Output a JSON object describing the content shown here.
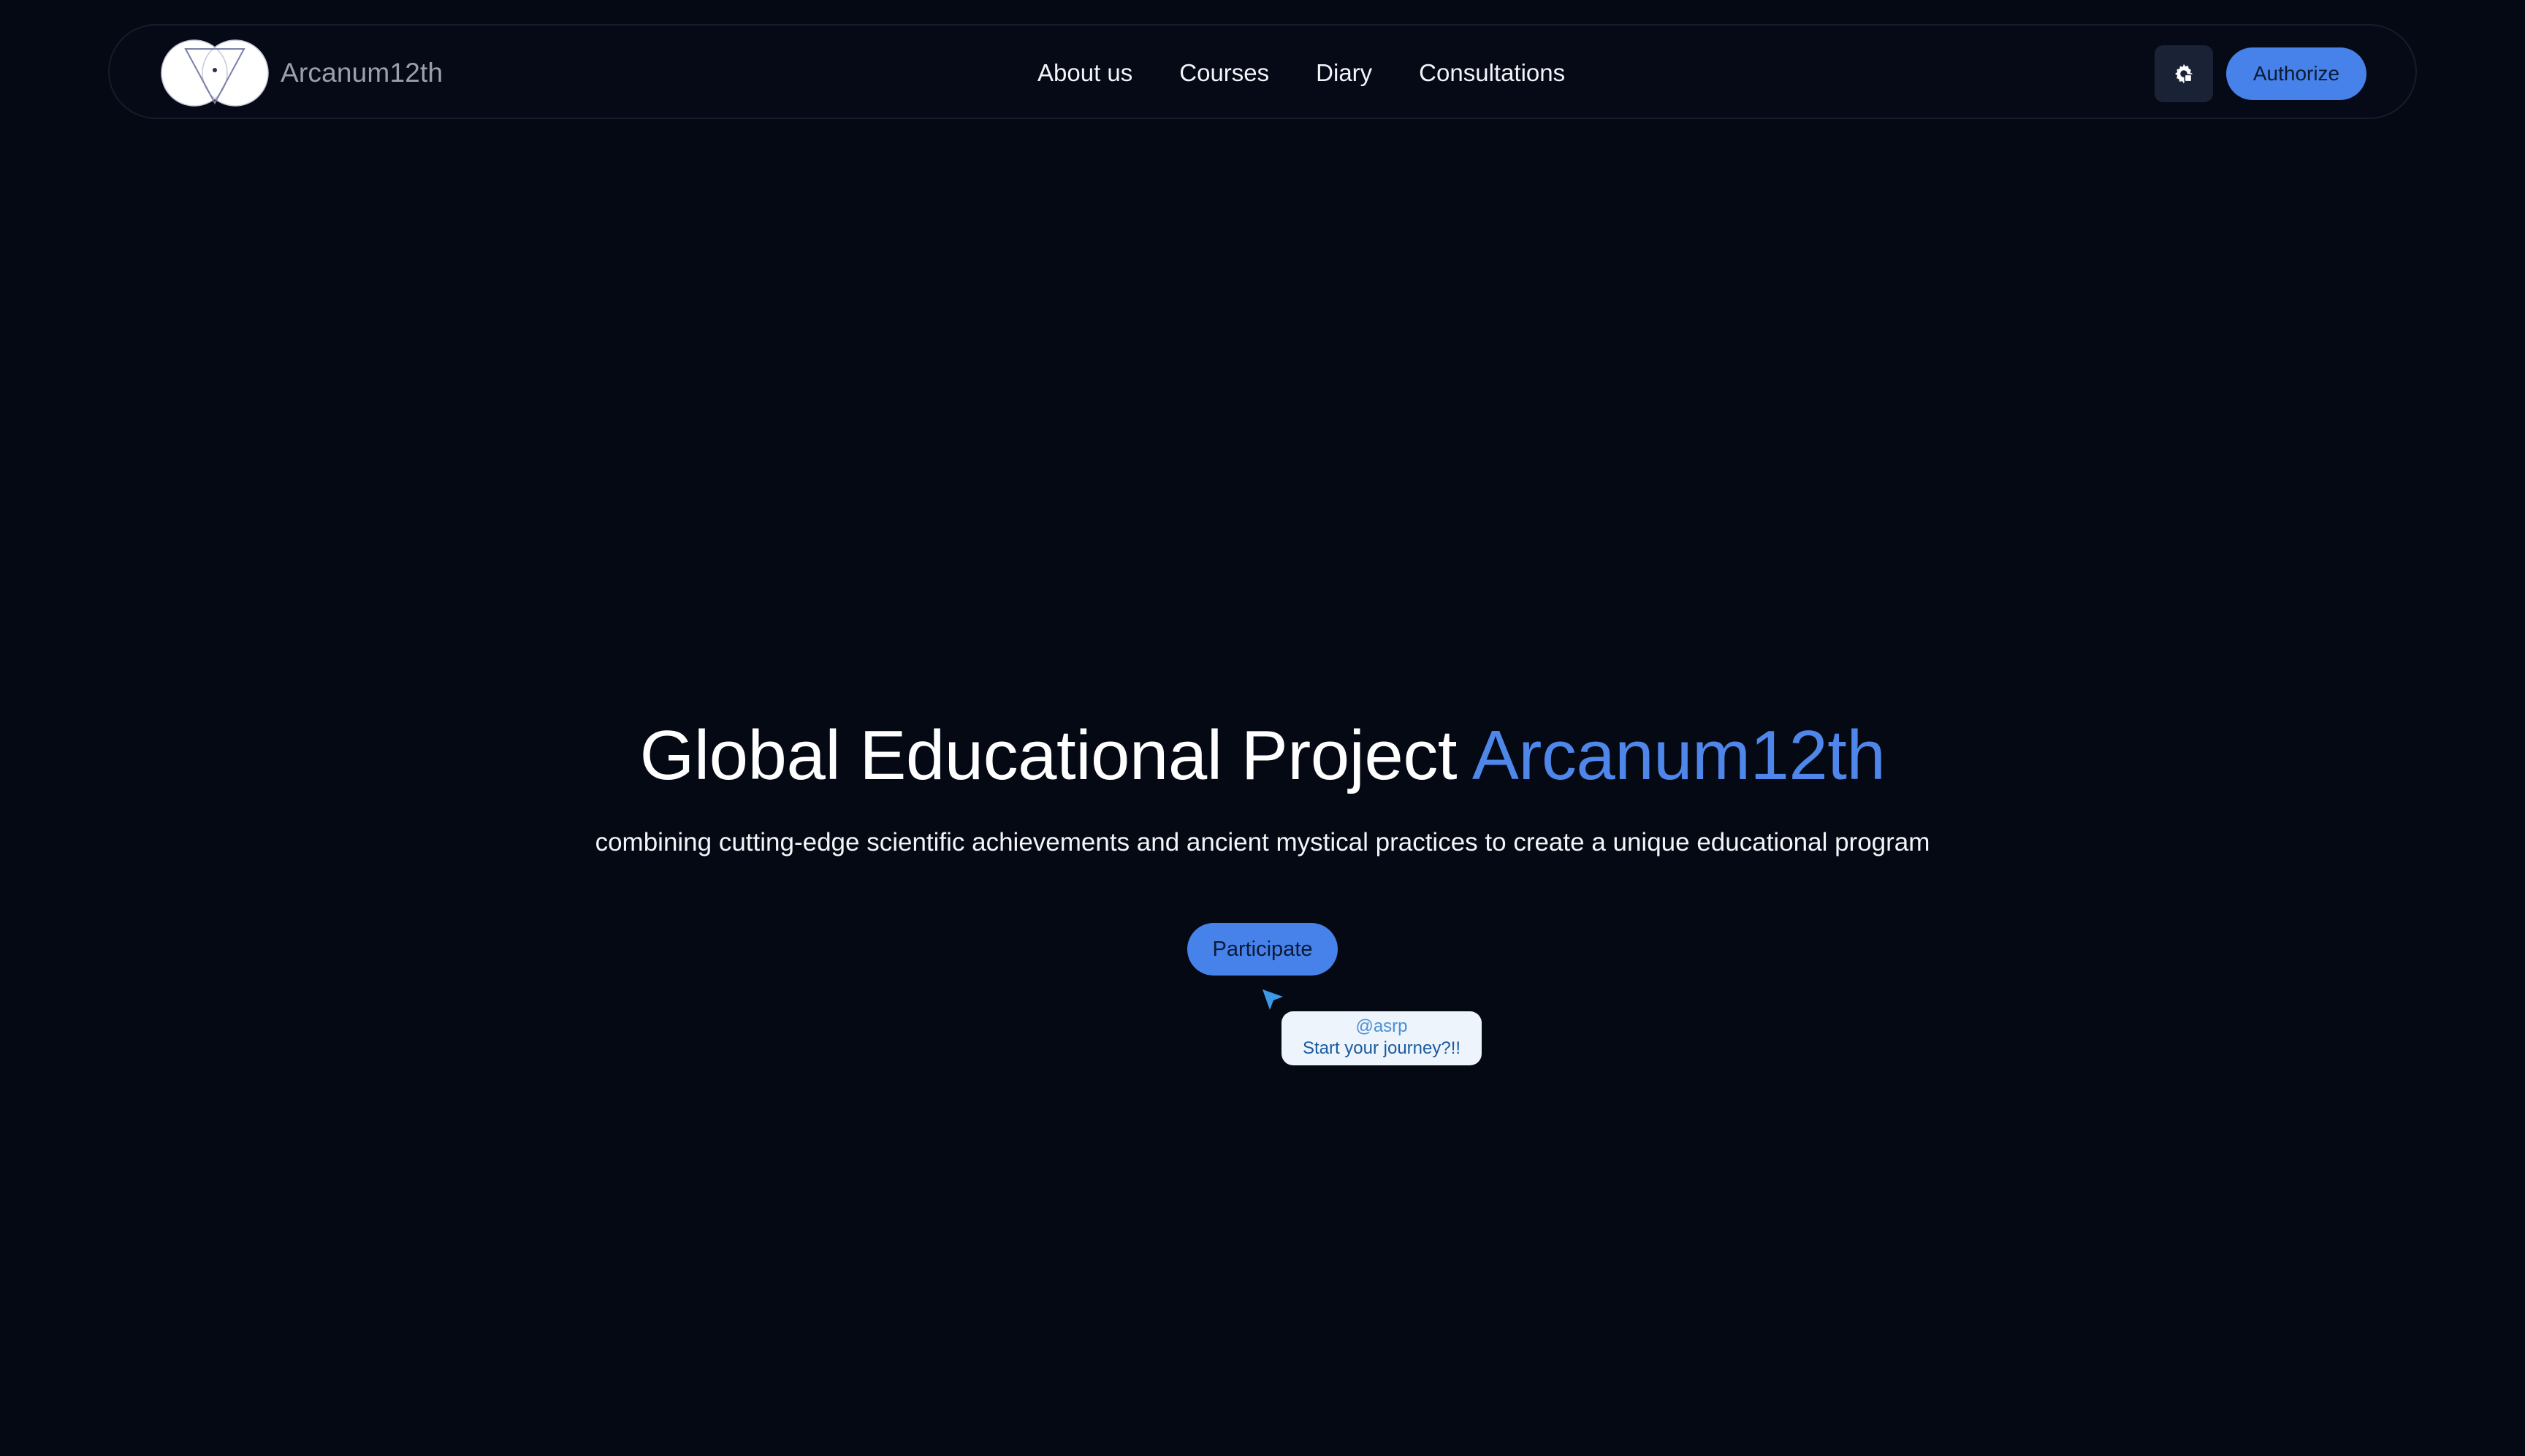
{
  "header": {
    "brand_name": "Arcanum12th",
    "nav": [
      {
        "label": "About us"
      },
      {
        "label": "Courses"
      },
      {
        "label": "Diary"
      },
      {
        "label": "Consultations"
      }
    ],
    "settings_icon": "gear-icon",
    "authorize_label": "Authorize"
  },
  "hero": {
    "title_prefix": "Global Educational Project ",
    "title_highlight": "Arcanum12th",
    "subtitle": "combining cutting-edge scientific achievements and ancient mystical practices to create a unique educational program",
    "participate_label": "Participate"
  },
  "cursor_bubble": {
    "username": "@asrp",
    "message": "Start your journey?!!"
  },
  "colors": {
    "background": "#050914",
    "accent": "#4f86ea",
    "button": "#4682ea",
    "cursor": "#3b9ae8"
  }
}
